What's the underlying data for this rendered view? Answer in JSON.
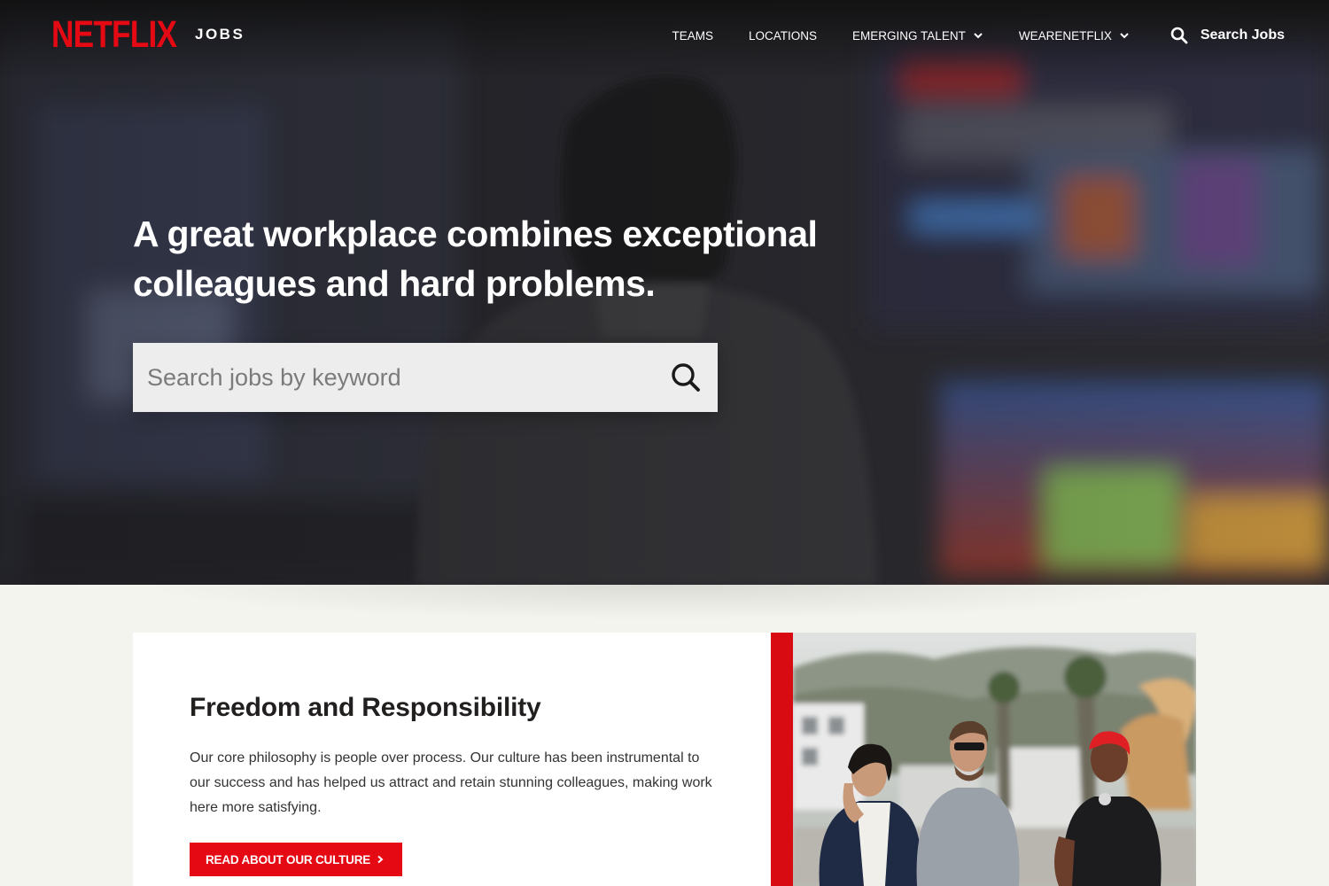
{
  "brand": {
    "logo": "NETFLIX",
    "section": "JOBS",
    "accent": "#e50914"
  },
  "nav": {
    "links": [
      {
        "label": "TEAMS",
        "has_dropdown": false
      },
      {
        "label": "LOCATIONS",
        "has_dropdown": false
      },
      {
        "label": "EMERGING TALENT",
        "has_dropdown": true
      },
      {
        "label": "WEARENETFLIX",
        "has_dropdown": true
      }
    ],
    "search_label": "Search Jobs",
    "icons": {
      "search": "search-icon",
      "dropdown": "chevron-down-icon"
    }
  },
  "hero": {
    "headline": "A great workplace combines exceptional colleagues and hard problems.",
    "search": {
      "placeholder": "Search jobs by keyword",
      "value": ""
    }
  },
  "feature": {
    "title": "Freedom and Responsibility",
    "body": "Our core philosophy is people over process. Our culture has been instrumental to our success and has helped us attract and retain stunning colleagues, making work here more satisfying.",
    "cta_label": "READ ABOUT OUR CULTURE",
    "accent_bar_color": "#d80b12"
  }
}
